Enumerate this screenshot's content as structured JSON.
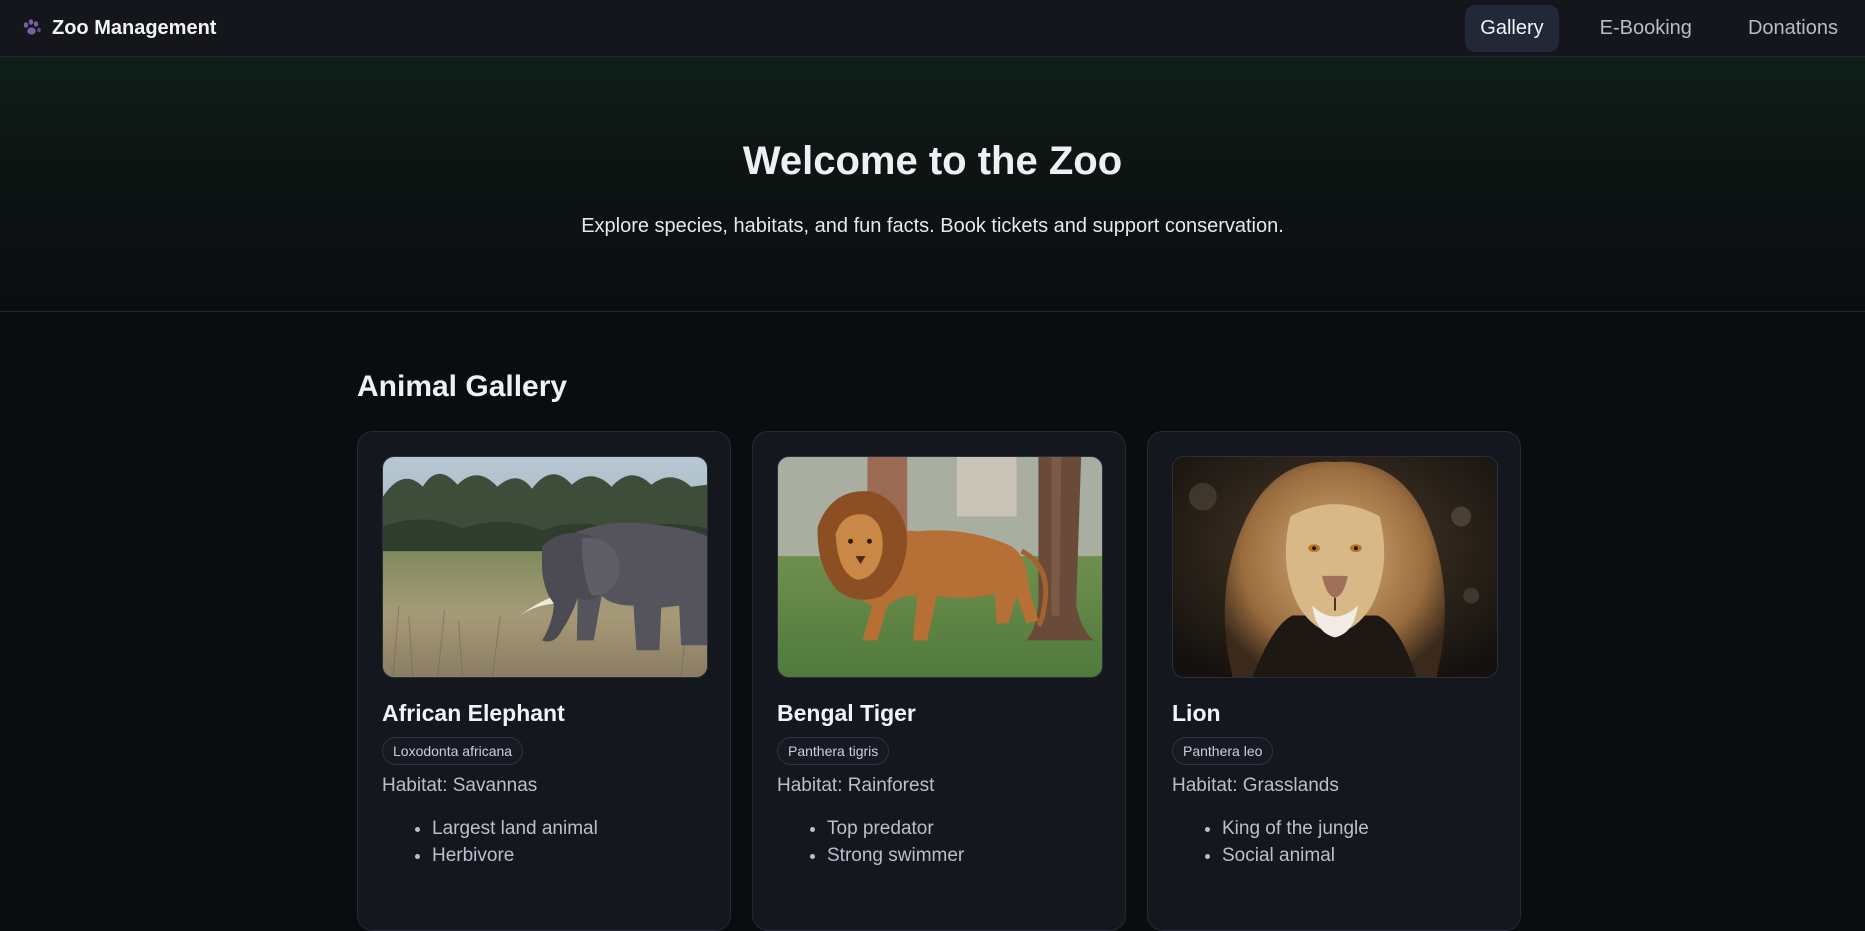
{
  "app": {
    "brand_icon": "paw-icon",
    "brand_title": "Zoo Management"
  },
  "nav": {
    "items": [
      {
        "label": "Gallery",
        "active": true
      },
      {
        "label": "E-Booking",
        "active": false
      },
      {
        "label": "Donations",
        "active": false
      }
    ]
  },
  "hero": {
    "title": "Welcome to the Zoo",
    "subtitle": "Explore species, habitats, and fun facts. Book tickets and support conservation."
  },
  "gallery": {
    "title": "Animal Gallery",
    "cards": [
      {
        "name": "African Elephant",
        "scientific": "Loxodonta africana",
        "habitat": "Habitat: Savannas",
        "facts": [
          "Largest land animal",
          "Herbivore"
        ],
        "image": "elephant-photo"
      },
      {
        "name": "Bengal Tiger",
        "scientific": "Panthera tigris",
        "habitat": "Habitat: Rainforest",
        "facts": [
          "Top predator",
          "Strong swimmer"
        ],
        "image": "walking-lion-photo"
      },
      {
        "name": "Lion",
        "scientific": "Panthera leo",
        "habitat": "Habitat: Grasslands",
        "facts": [
          "King of the jungle",
          "Social animal"
        ],
        "image": "lion-portrait-photo"
      }
    ]
  },
  "colors": {
    "background": "#0b0c10",
    "surface": "#15171e",
    "nav_active": "#232838",
    "text_primary": "#eef0f5",
    "text_muted": "#b9bfcc",
    "paw_purple": "#7a5fa8"
  }
}
